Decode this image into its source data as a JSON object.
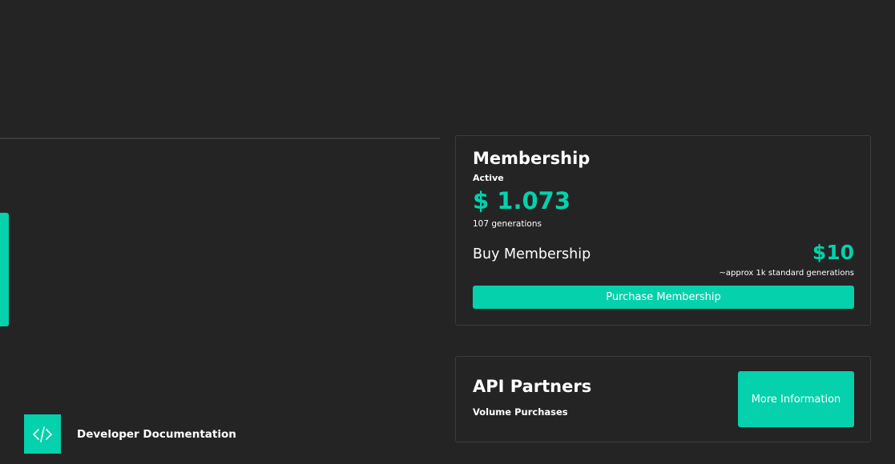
{
  "membership": {
    "title": "Membership",
    "status": "Active",
    "balance": "$ 1.073",
    "generations": "107 generations",
    "buy_label": "Buy Membership",
    "price": "$10",
    "approx_note": "~approx 1k standard generations",
    "purchase_button": "Purchase Membership"
  },
  "api_partners": {
    "title": "API Partners",
    "subtitle": "Volume Purchases",
    "more_info_button": "More Information"
  },
  "developer_docs": {
    "label": "Developer Documentation",
    "icon": "code-icon"
  },
  "colors": {
    "background": "#242424",
    "accent": "#05d1ac",
    "border": "#3c3c3c"
  }
}
